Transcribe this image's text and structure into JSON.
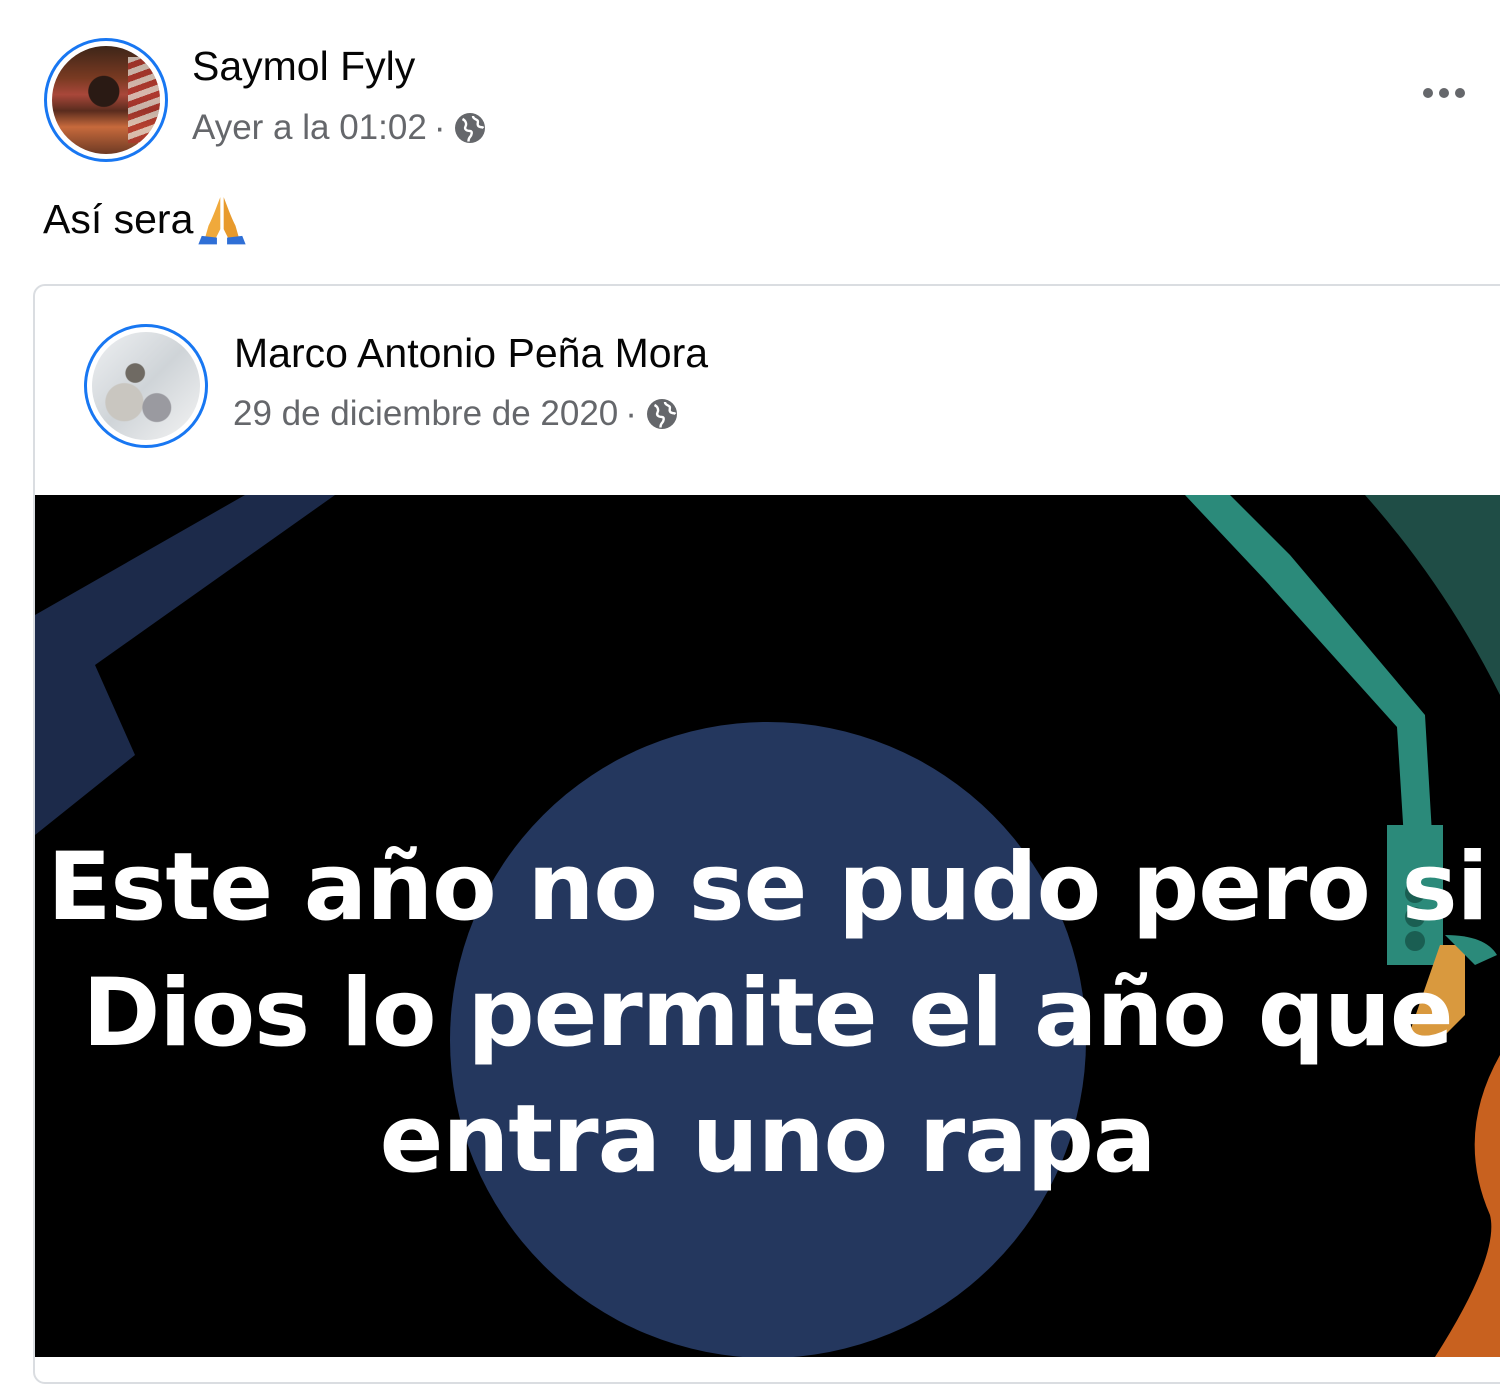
{
  "post": {
    "author": "Saymol Fyly",
    "timestamp": "Ayer a la 01:02",
    "separator": "·",
    "privacy_icon": "globe-icon",
    "text": "Así sera",
    "emoji": "folded-hands",
    "more_icon": "more-horizontal-icon"
  },
  "shared_post": {
    "author": "Marco Antonio Peña Mora",
    "timestamp": "29 de diciembre de 2020",
    "separator": "·",
    "privacy_icon": "globe-icon",
    "image_caption_lines": [
      "Este año no se pudo pero si",
      "Dios lo permite el año que",
      "entra uno rapa"
    ]
  },
  "colors": {
    "accent": "#1877f2",
    "name_text": "#050505",
    "meta_text": "#65676b",
    "card_border": "#dadde1",
    "image_background": "#000000",
    "image_circle": "#24375e",
    "image_arm": "#2b8a7a",
    "image_accent_orange": "#c8611f"
  }
}
